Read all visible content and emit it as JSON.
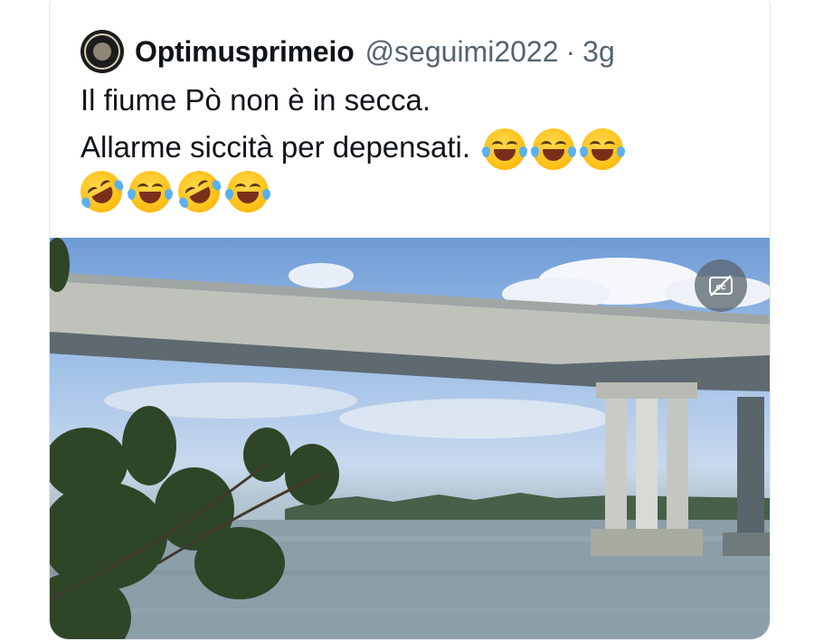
{
  "tweet": {
    "author_name": "Optimusprimeio",
    "handle": "@seguimi2022",
    "separator": "·",
    "timestamp": "3g",
    "text_line1": "Il fiume Pò non è in secca.",
    "text_line2": "Allarme siccità per depensati.",
    "emoji_line2": [
      "face-with-tears-of-joy",
      "face-with-tears-of-joy",
      "face-with-tears-of-joy"
    ],
    "emoji_line3": [
      "rolling-on-the-floor-laughing",
      "face-with-tears-of-joy",
      "rolling-on-the-floor-laughing",
      "face-with-tears-of-joy"
    ]
  },
  "media": {
    "type": "video",
    "cc_icon": "closed-captions-off-icon"
  },
  "colors": {
    "text": "#0f1419",
    "secondary": "#536471",
    "border": "#e3e7ea"
  }
}
